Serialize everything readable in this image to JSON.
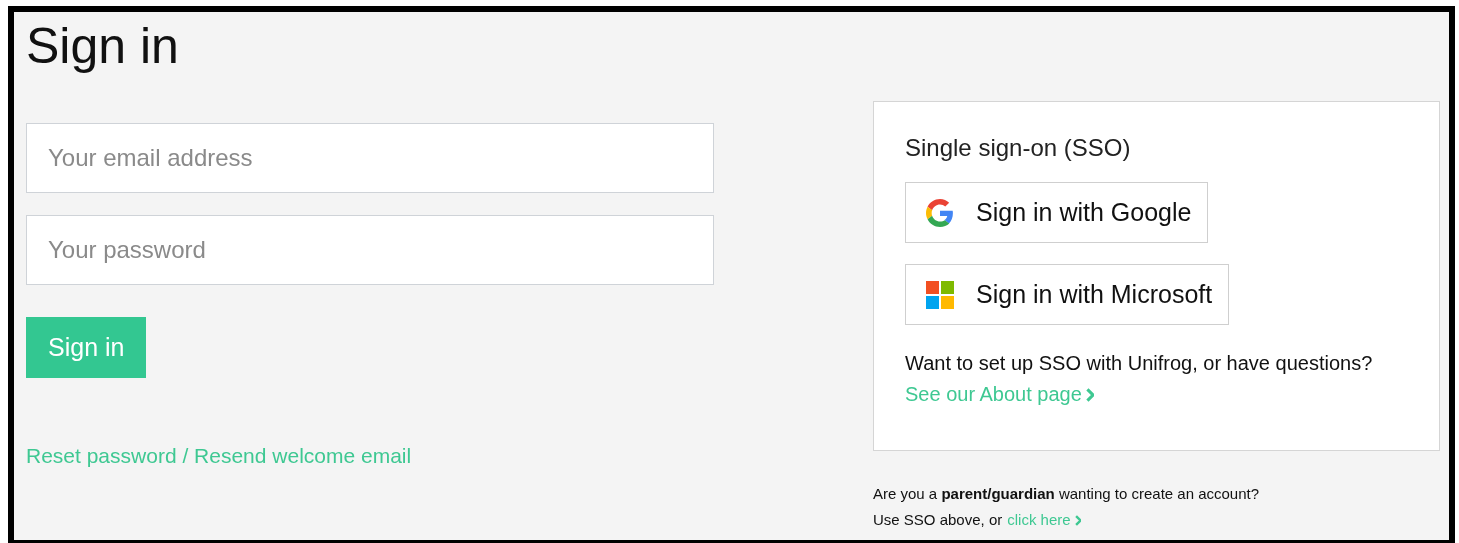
{
  "page": {
    "title": "Sign in"
  },
  "login_form": {
    "email": {
      "placeholder": "Your email address"
    },
    "password": {
      "placeholder": "Your password"
    },
    "submit": "Sign in",
    "reset_link": "Reset password / Resend welcome email"
  },
  "sso": {
    "heading": "Single sign-on (SSO)",
    "providers": [
      {
        "kind": "google",
        "label": "Sign in with Google"
      },
      {
        "kind": "microsoft",
        "label": "Sign in with Microsoft"
      }
    ],
    "question": "Want to set up SSO with Unifrog, or have questions?",
    "about_link": "See our About page"
  },
  "parent_note": {
    "question": "Are you a **parent/guardian** wanting to create an account?",
    "prompt": "Use SSO above, or",
    "link": "click here"
  }
}
